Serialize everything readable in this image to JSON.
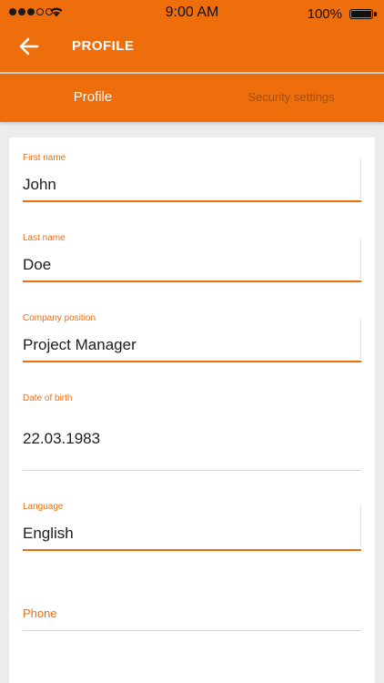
{
  "status_bar": {
    "time": "9:00 AM",
    "battery": "100%",
    "battery_level": 1.0,
    "signal_bars_filled": 3,
    "signal_bars_total": 5
  },
  "header": {
    "title": "PROFILE",
    "back_icon": "arrow-left-icon"
  },
  "tabs": [
    {
      "label": "Profile",
      "active": true
    },
    {
      "label": "Security settings",
      "active": false
    }
  ],
  "form": {
    "first_name": {
      "label": "First name",
      "value": "John"
    },
    "last_name": {
      "label": "Last name",
      "value": "Doe"
    },
    "company_position": {
      "label": "Company position",
      "value": "Project Manager"
    },
    "date_of_birth": {
      "label": "Date of birth",
      "value": "22.03.1983"
    },
    "language": {
      "label": "Language",
      "value": "English"
    },
    "phone": {
      "label": "Phone",
      "value": ""
    }
  },
  "colors": {
    "accent": "#ee6e0c",
    "tab_inactive": "#a74f0b",
    "background": "#ececec"
  }
}
